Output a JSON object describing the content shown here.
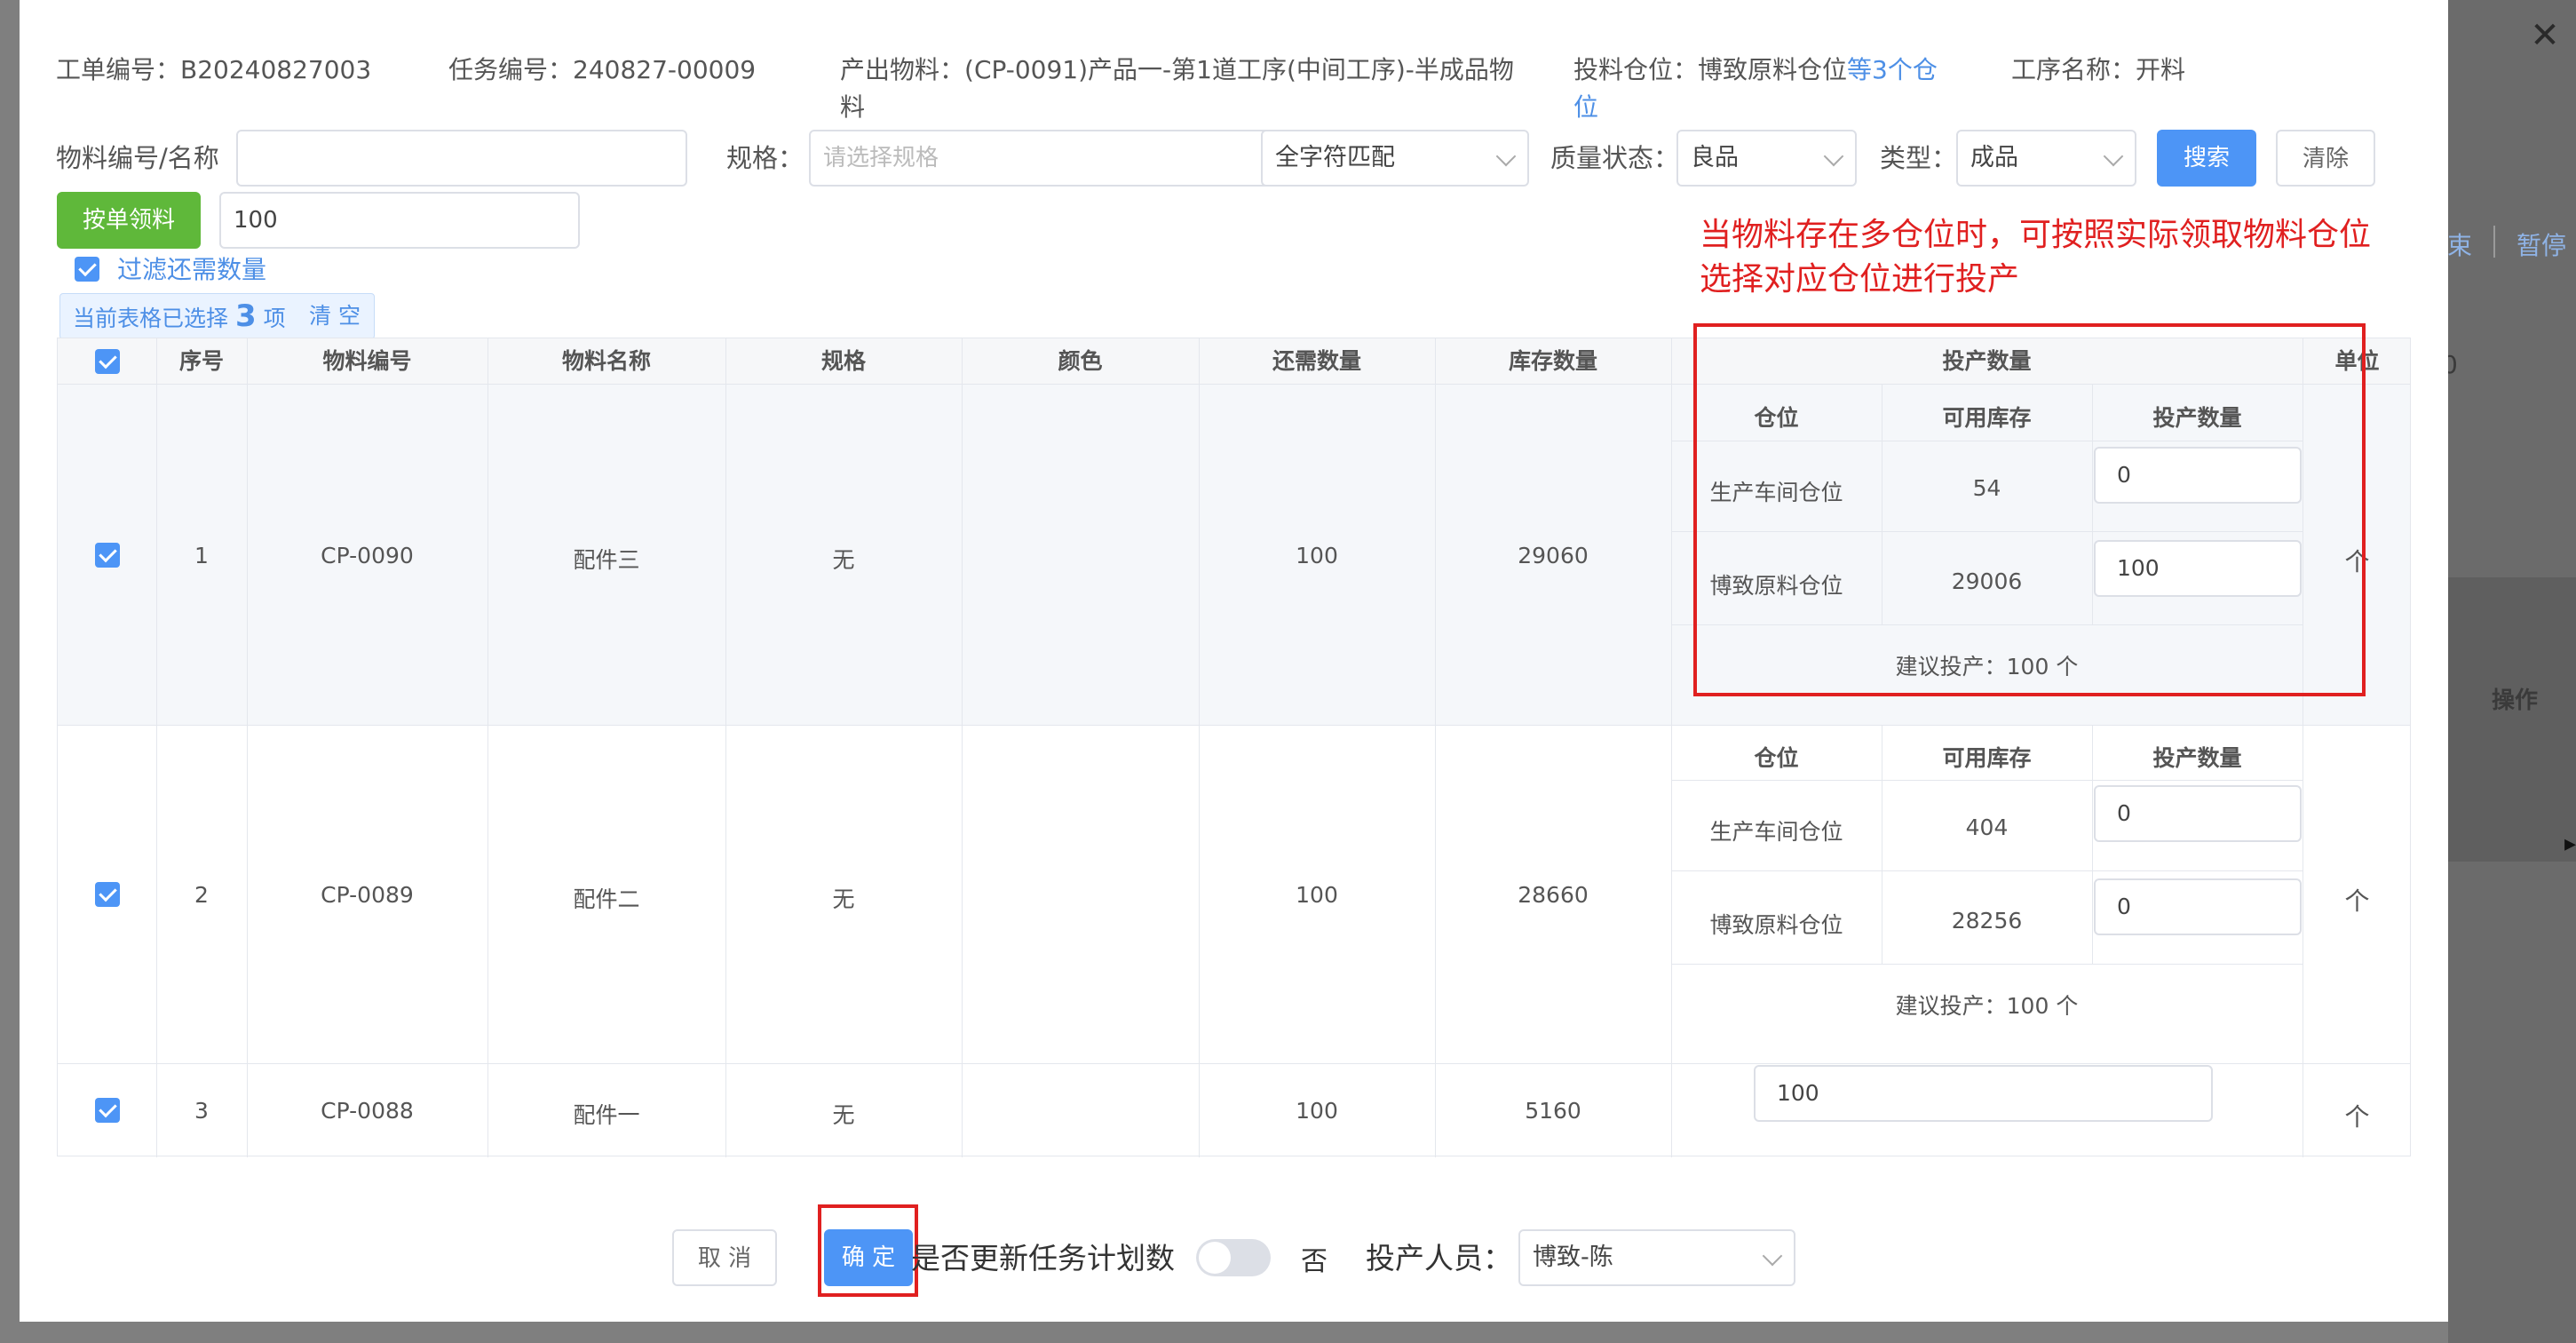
{
  "background": {
    "links": [
      "束",
      "暂停"
    ],
    "zero": "0",
    "op_header": "操作"
  },
  "header": {
    "order_no_label": "工单编号：",
    "order_no": "B20240827003",
    "task_no_label": "任务编号：",
    "task_no": "240827-00009",
    "output_label": "产出物料：",
    "output_line1": "(CP-0091)产品一-第1道工序(中间工序)-半成品物",
    "output_line2": "料",
    "feed_loc_label": "投料仓位：",
    "feed_loc_value": "博致原料仓位",
    "feed_loc_more1": "等3个仓",
    "feed_loc_more2": "位",
    "process_label": "工序名称：",
    "process_value": "开料"
  },
  "filters": {
    "material_label": "物料编号/名称",
    "material_value": "",
    "spec_label": "规格：",
    "spec_placeholder": "请选择规格",
    "match_mode": "全字符匹配",
    "quality_label": "质量状态：",
    "quality_value": "良品",
    "type_label": "类型：",
    "type_value": "成品",
    "search_btn": "搜索",
    "clear_btn": "清除",
    "by_order_btn": "按单领料",
    "qty_value": "100",
    "filter_check_label": "过滤还需数量"
  },
  "selection": {
    "prefix": "当前表格已选择",
    "count": "3",
    "suffix": "项",
    "clear": "清 空"
  },
  "table": {
    "headers": [
      "序号",
      "物料编号",
      "物料名称",
      "规格",
      "颜色",
      "还需数量",
      "库存数量",
      "投产数量",
      "单位"
    ],
    "sub_headers": [
      "仓位",
      "可用库存",
      "投产数量"
    ],
    "rows": [
      {
        "index": "1",
        "code": "CP-0090",
        "name": "配件三",
        "spec": "无",
        "color": "",
        "need": "100",
        "stock": "29060",
        "unit": "个",
        "locations": [
          {
            "name": "生产车间仓位",
            "available": "54",
            "qty": "0"
          },
          {
            "name": "博致原料仓位",
            "available": "29006",
            "qty": "100"
          }
        ],
        "suggest": "建议投产：100 个"
      },
      {
        "index": "2",
        "code": "CP-0089",
        "name": "配件二",
        "spec": "无",
        "color": "",
        "need": "100",
        "stock": "28660",
        "unit": "个",
        "locations": [
          {
            "name": "生产车间仓位",
            "available": "404",
            "qty": "0"
          },
          {
            "name": "博致原料仓位",
            "available": "28256",
            "qty": "0"
          }
        ],
        "suggest": "建议投产：100 个"
      },
      {
        "index": "3",
        "code": "CP-0088",
        "name": "配件一",
        "spec": "无",
        "color": "",
        "need": "100",
        "stock": "5160",
        "unit": "个",
        "qty": "100"
      }
    ]
  },
  "annotation": {
    "line1": "当物料存在多仓位时，可按照实际领取物料仓位",
    "line2": "选择对应仓位进行投产",
    "color": "#e02020"
  },
  "footer": {
    "cancel": "取 消",
    "confirm": "确 定",
    "update_plan_label": "是否更新任务计划数",
    "toggle_state": "否",
    "operator_label": "投产人员：",
    "operator_value": "博致-陈"
  },
  "colors": {
    "primary": "#4d95f6",
    "green": "#5fb83a",
    "annotation_red": "#e02020"
  }
}
